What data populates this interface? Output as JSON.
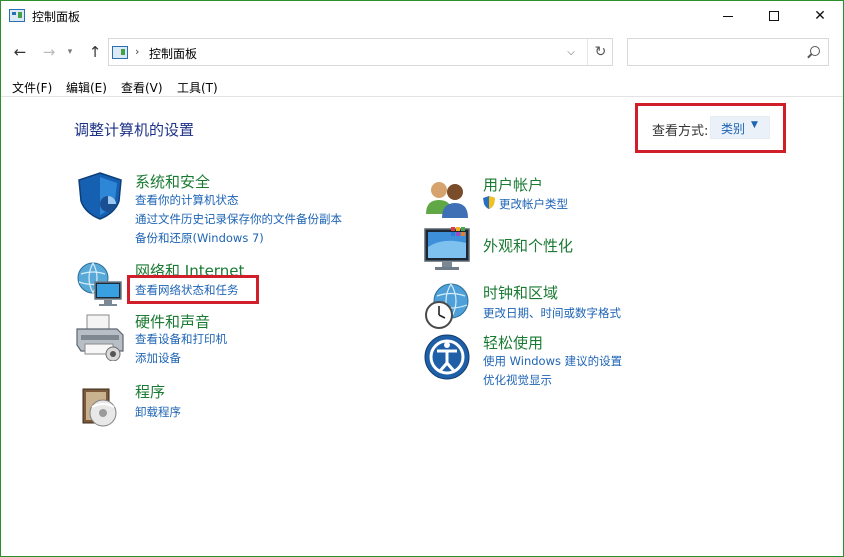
{
  "window": {
    "title": "控制面板",
    "icons": {
      "minimize": "minimize-icon",
      "maximize": "maximize-icon",
      "close": "close-icon"
    }
  },
  "nav": {
    "address_path": "控制面板",
    "search_placeholder": ""
  },
  "menu": {
    "file": "文件(F)",
    "edit": "编辑(E)",
    "view": "查看(V)",
    "tools": "工具(T)"
  },
  "content": {
    "heading": "调整计算机的设置",
    "view_by": {
      "label": "查看方式:",
      "value": "类别"
    },
    "left": [
      {
        "title": "系统和安全",
        "icon": "shield-icon",
        "links": [
          "查看你的计算机状态",
          "通过文件历史记录保存你的文件备份副本",
          "备份和还原(Windows 7)"
        ]
      },
      {
        "title": "网络和 Internet",
        "icon": "network-globe-icon",
        "links": [
          "查看网络状态和任务"
        ]
      },
      {
        "title": "硬件和声音",
        "icon": "printer-icon",
        "links": [
          "查看设备和打印机",
          "添加设备"
        ]
      },
      {
        "title": "程序",
        "icon": "programs-disc-icon",
        "links": [
          "卸载程序"
        ]
      }
    ],
    "right": [
      {
        "title": "用户帐户",
        "icon": "users-icon",
        "links": [
          "更改帐户类型"
        ]
      },
      {
        "title": "外观和个性化",
        "icon": "monitor-icon",
        "links": []
      },
      {
        "title": "时钟和区域",
        "icon": "clock-globe-icon",
        "links": [
          "更改日期、时间或数字格式"
        ]
      },
      {
        "title": "轻松使用",
        "icon": "ease-of-access-icon",
        "links": [
          "使用 Windows 建议的设置",
          "优化视觉显示"
        ]
      }
    ]
  },
  "colors": {
    "category_title": "#1a7a32",
    "link": "#1e64b4",
    "heading": "#1e3287",
    "highlight_box": "#d01e2b",
    "window_border": "#2b8f2b"
  }
}
